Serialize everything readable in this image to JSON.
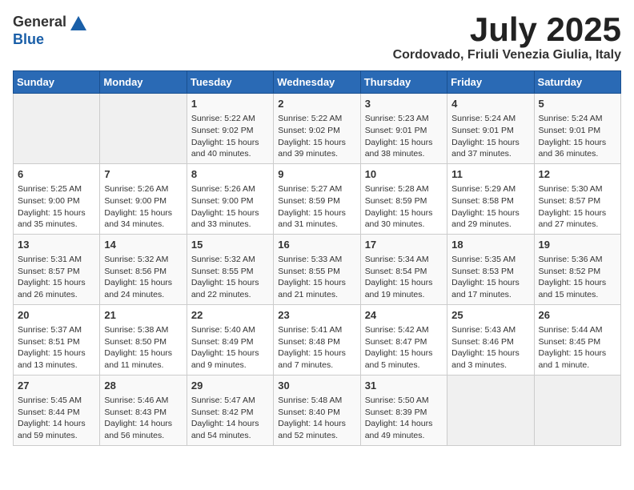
{
  "header": {
    "logo_line1": "General",
    "logo_line2": "Blue",
    "month": "July 2025",
    "location": "Cordovado, Friuli Venezia Giulia, Italy"
  },
  "days_of_week": [
    "Sunday",
    "Monday",
    "Tuesday",
    "Wednesday",
    "Thursday",
    "Friday",
    "Saturday"
  ],
  "weeks": [
    [
      {
        "day": "",
        "info": ""
      },
      {
        "day": "",
        "info": ""
      },
      {
        "day": "1",
        "info": "Sunrise: 5:22 AM\nSunset: 9:02 PM\nDaylight: 15 hours and 40 minutes."
      },
      {
        "day": "2",
        "info": "Sunrise: 5:22 AM\nSunset: 9:02 PM\nDaylight: 15 hours and 39 minutes."
      },
      {
        "day": "3",
        "info": "Sunrise: 5:23 AM\nSunset: 9:01 PM\nDaylight: 15 hours and 38 minutes."
      },
      {
        "day": "4",
        "info": "Sunrise: 5:24 AM\nSunset: 9:01 PM\nDaylight: 15 hours and 37 minutes."
      },
      {
        "day": "5",
        "info": "Sunrise: 5:24 AM\nSunset: 9:01 PM\nDaylight: 15 hours and 36 minutes."
      }
    ],
    [
      {
        "day": "6",
        "info": "Sunrise: 5:25 AM\nSunset: 9:00 PM\nDaylight: 15 hours and 35 minutes."
      },
      {
        "day": "7",
        "info": "Sunrise: 5:26 AM\nSunset: 9:00 PM\nDaylight: 15 hours and 34 minutes."
      },
      {
        "day": "8",
        "info": "Sunrise: 5:26 AM\nSunset: 9:00 PM\nDaylight: 15 hours and 33 minutes."
      },
      {
        "day": "9",
        "info": "Sunrise: 5:27 AM\nSunset: 8:59 PM\nDaylight: 15 hours and 31 minutes."
      },
      {
        "day": "10",
        "info": "Sunrise: 5:28 AM\nSunset: 8:59 PM\nDaylight: 15 hours and 30 minutes."
      },
      {
        "day": "11",
        "info": "Sunrise: 5:29 AM\nSunset: 8:58 PM\nDaylight: 15 hours and 29 minutes."
      },
      {
        "day": "12",
        "info": "Sunrise: 5:30 AM\nSunset: 8:57 PM\nDaylight: 15 hours and 27 minutes."
      }
    ],
    [
      {
        "day": "13",
        "info": "Sunrise: 5:31 AM\nSunset: 8:57 PM\nDaylight: 15 hours and 26 minutes."
      },
      {
        "day": "14",
        "info": "Sunrise: 5:32 AM\nSunset: 8:56 PM\nDaylight: 15 hours and 24 minutes."
      },
      {
        "day": "15",
        "info": "Sunrise: 5:32 AM\nSunset: 8:55 PM\nDaylight: 15 hours and 22 minutes."
      },
      {
        "day": "16",
        "info": "Sunrise: 5:33 AM\nSunset: 8:55 PM\nDaylight: 15 hours and 21 minutes."
      },
      {
        "day": "17",
        "info": "Sunrise: 5:34 AM\nSunset: 8:54 PM\nDaylight: 15 hours and 19 minutes."
      },
      {
        "day": "18",
        "info": "Sunrise: 5:35 AM\nSunset: 8:53 PM\nDaylight: 15 hours and 17 minutes."
      },
      {
        "day": "19",
        "info": "Sunrise: 5:36 AM\nSunset: 8:52 PM\nDaylight: 15 hours and 15 minutes."
      }
    ],
    [
      {
        "day": "20",
        "info": "Sunrise: 5:37 AM\nSunset: 8:51 PM\nDaylight: 15 hours and 13 minutes."
      },
      {
        "day": "21",
        "info": "Sunrise: 5:38 AM\nSunset: 8:50 PM\nDaylight: 15 hours and 11 minutes."
      },
      {
        "day": "22",
        "info": "Sunrise: 5:40 AM\nSunset: 8:49 PM\nDaylight: 15 hours and 9 minutes."
      },
      {
        "day": "23",
        "info": "Sunrise: 5:41 AM\nSunset: 8:48 PM\nDaylight: 15 hours and 7 minutes."
      },
      {
        "day": "24",
        "info": "Sunrise: 5:42 AM\nSunset: 8:47 PM\nDaylight: 15 hours and 5 minutes."
      },
      {
        "day": "25",
        "info": "Sunrise: 5:43 AM\nSunset: 8:46 PM\nDaylight: 15 hours and 3 minutes."
      },
      {
        "day": "26",
        "info": "Sunrise: 5:44 AM\nSunset: 8:45 PM\nDaylight: 15 hours and 1 minute."
      }
    ],
    [
      {
        "day": "27",
        "info": "Sunrise: 5:45 AM\nSunset: 8:44 PM\nDaylight: 14 hours and 59 minutes."
      },
      {
        "day": "28",
        "info": "Sunrise: 5:46 AM\nSunset: 8:43 PM\nDaylight: 14 hours and 56 minutes."
      },
      {
        "day": "29",
        "info": "Sunrise: 5:47 AM\nSunset: 8:42 PM\nDaylight: 14 hours and 54 minutes."
      },
      {
        "day": "30",
        "info": "Sunrise: 5:48 AM\nSunset: 8:40 PM\nDaylight: 14 hours and 52 minutes."
      },
      {
        "day": "31",
        "info": "Sunrise: 5:50 AM\nSunset: 8:39 PM\nDaylight: 14 hours and 49 minutes."
      },
      {
        "day": "",
        "info": ""
      },
      {
        "day": "",
        "info": ""
      }
    ]
  ]
}
